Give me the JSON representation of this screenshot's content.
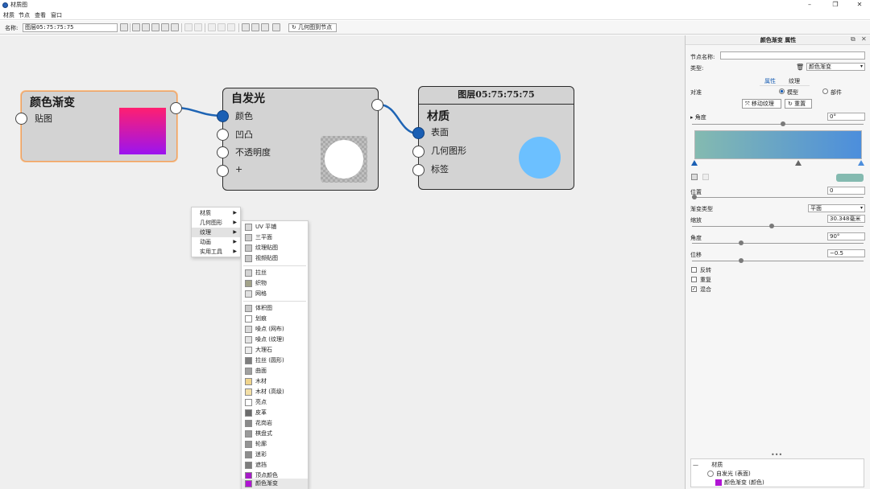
{
  "window": {
    "title": "材质图",
    "controls": [
      "–",
      "❐",
      "✕"
    ]
  },
  "menu": [
    "材质",
    "节点",
    "查看",
    "窗口"
  ],
  "toolbar": {
    "name_label": "名称:",
    "name_value": "图层05:75:75:75",
    "to_node_label": "几何图到节点"
  },
  "nodes": {
    "gradient": {
      "title": "颜色渐变",
      "ports": [
        "贴图"
      ]
    },
    "emission": {
      "title": "自发光",
      "ports": [
        "颜色",
        "凹凸",
        "不透明度",
        "+"
      ]
    },
    "material": {
      "header": "图层05:75:75:75",
      "title": "材质",
      "ports": [
        "表面",
        "几何图形",
        "标签"
      ]
    }
  },
  "context_menu": {
    "items": [
      "材质",
      "几何图形",
      "纹理",
      "动画",
      "实用工具"
    ],
    "highlighted": 2
  },
  "submenu": {
    "groups": [
      [
        "UV 平铺",
        "三平面",
        "纹理贴图",
        "视频贴图"
      ],
      [
        "拉丝",
        "织物",
        "网格"
      ],
      [
        "体积图",
        "划痕",
        "噪点 (网布)",
        "噪点 (纹理)",
        "大理石",
        "拉丝 (圆形)",
        "曲面",
        "木材",
        "木材 (高级)",
        "亮点",
        "皮革",
        "花岗岩",
        "棋盘式",
        "轮廓",
        "迷彩",
        "遮挡",
        "顶点颜色",
        "颜色渐变"
      ]
    ],
    "highlighted_item": "颜色渐变",
    "icon_colors": {
      "木材": "#f0d48c",
      "木材 (高级)": "#f3dfa6",
      "顶点颜色": "#a61cc7",
      "颜色渐变": "#b014d4"
    }
  },
  "panel": {
    "title": "颜色渐变  属性",
    "node_name_label": "节点名称:",
    "node_name_value": "",
    "type_label": "类型:",
    "type_value": "颜色渐变",
    "tabs": [
      "属性",
      "纹理"
    ],
    "active_tab": 0,
    "mapping_label": "对准",
    "mapping_options": [
      "模型",
      "部件"
    ],
    "mapping_selected": 0,
    "move_texture_btn": "移动纹理",
    "reset_btn": "重置",
    "angle_label": "角度",
    "angle_value": "0°",
    "position_label": "位置",
    "position_value": "0",
    "gradient_type_label": "渐变类型",
    "gradient_type_value": "平面",
    "scale_label": "缩放",
    "scale_value": "30.348毫米",
    "angle2_label": "角度",
    "angle2_value": "90°",
    "offset_label": "位移",
    "offset_value": "−0.5",
    "checkboxes": [
      {
        "label": "反转",
        "checked": false
      },
      {
        "label": "重复",
        "checked": false
      },
      {
        "label": "混合",
        "checked": true
      }
    ],
    "gradient_colors": [
      "#84bab0",
      "#4c8edc"
    ],
    "gradient_stops": [
      0,
      1
    ],
    "gradient_midpoint": 0.5,
    "tree": [
      {
        "label": "材质",
        "depth": 0
      },
      {
        "label": "自发光 (表面)",
        "depth": 1
      },
      {
        "label": "颜色渐变 (颜色)",
        "depth": 2
      }
    ]
  }
}
